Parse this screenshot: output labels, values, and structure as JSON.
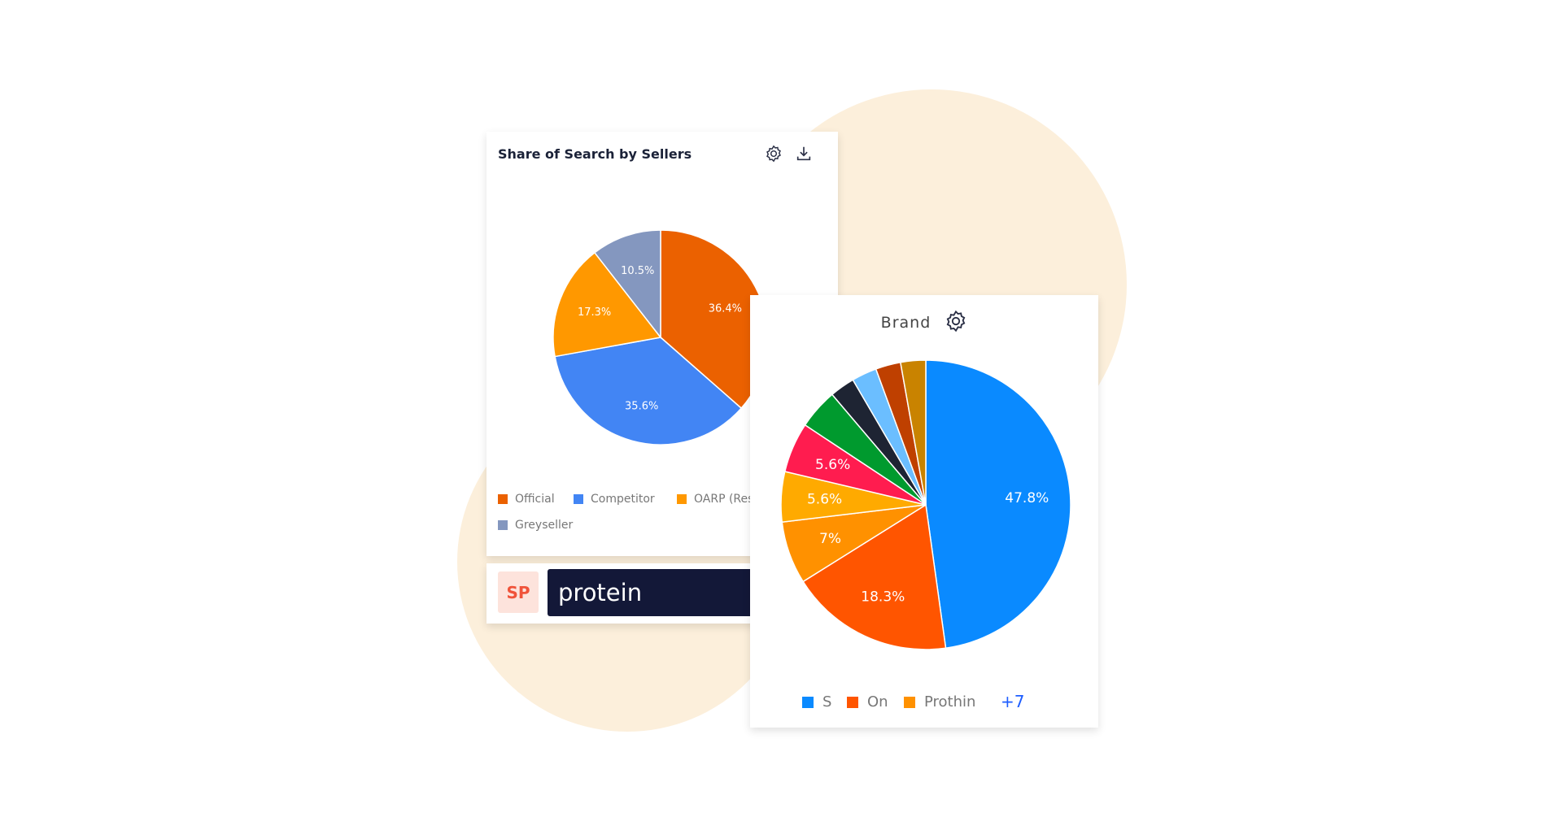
{
  "colors": {
    "background_blob": "#FCEFDB",
    "keyword_box": "#131838",
    "sp_badge_bg": "#FDE3DC",
    "sp_badge_text": "#F0533A",
    "more_link": "#1E5EFF"
  },
  "sellers_card": {
    "title": "Share of Search by Sellers",
    "icons": [
      "gear-icon",
      "download-icon"
    ]
  },
  "brand_card": {
    "title": "Brand",
    "icons": [
      "gear-icon"
    ],
    "more_label": "+7"
  },
  "keyword": {
    "badge": "SP",
    "value": "protein"
  },
  "chart_data": [
    {
      "type": "pie",
      "title": "Share of Search by Sellers",
      "legend": "bottom",
      "slices": [
        {
          "name": "Official",
          "value": 36.4,
          "label": "36.4%",
          "color": "#EB6100"
        },
        {
          "name": "Competitor",
          "value": 35.6,
          "label": "35.6%",
          "color": "#4285F4"
        },
        {
          "name": "OARP (Res",
          "value": 17.3,
          "label": "17.3%",
          "color": "#FF9800"
        },
        {
          "name": "Greyseller",
          "value": 10.5,
          "label": "10.5%",
          "color": "#8497BF"
        }
      ]
    },
    {
      "type": "pie",
      "title": "Brand",
      "legend": "bottom",
      "slices": [
        {
          "name": "S",
          "value": 47.8,
          "label": "47.8%",
          "color": "#0A8AFF",
          "legend": true
        },
        {
          "name": "On",
          "value": 18.3,
          "label": "18.3%",
          "color": "#FF5500",
          "legend": true
        },
        {
          "name": "Prothin",
          "value": 7,
          "label": "7%",
          "color": "#FF9100",
          "legend": true
        },
        {
          "value": 5.6,
          "label": "5.6%",
          "color": "#FFAA00"
        },
        {
          "value": 5.6,
          "label": "5.6%",
          "color": "#FF1C4F"
        },
        {
          "value": 4.5,
          "label": "",
          "color": "#009A2E"
        },
        {
          "value": 2.8,
          "label": "",
          "color": "#1E2433"
        },
        {
          "value": 2.8,
          "label": "",
          "color": "#6BBEFF"
        },
        {
          "value": 2.8,
          "label": "",
          "color": "#BF4000"
        },
        {
          "value": 2.8,
          "label": "",
          "color": "#C98300"
        }
      ]
    }
  ]
}
